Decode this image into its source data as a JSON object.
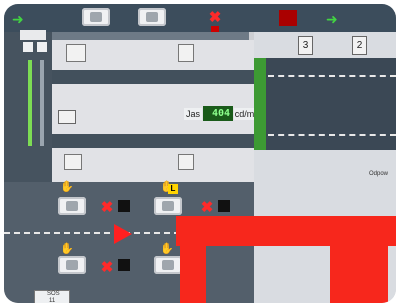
{
  "brightness": {
    "label": "Jas",
    "value": "404",
    "unit": "cd/m2"
  },
  "lane_numbers": [
    "3",
    "2"
  ],
  "right_label": "Odpow",
  "lower_badge": "L",
  "bottom_icon_text": [
    "SOS",
    "11"
  ],
  "icons": {
    "arrow": "green-arrow-icon",
    "x": "red-x-icon",
    "hand": "hand-icon",
    "car": "car-icon",
    "warning": "warning-triangle-icon"
  },
  "colors": {
    "red_bar": "#f7271c",
    "green": "#3d9a33",
    "road": "#3b4855"
  }
}
